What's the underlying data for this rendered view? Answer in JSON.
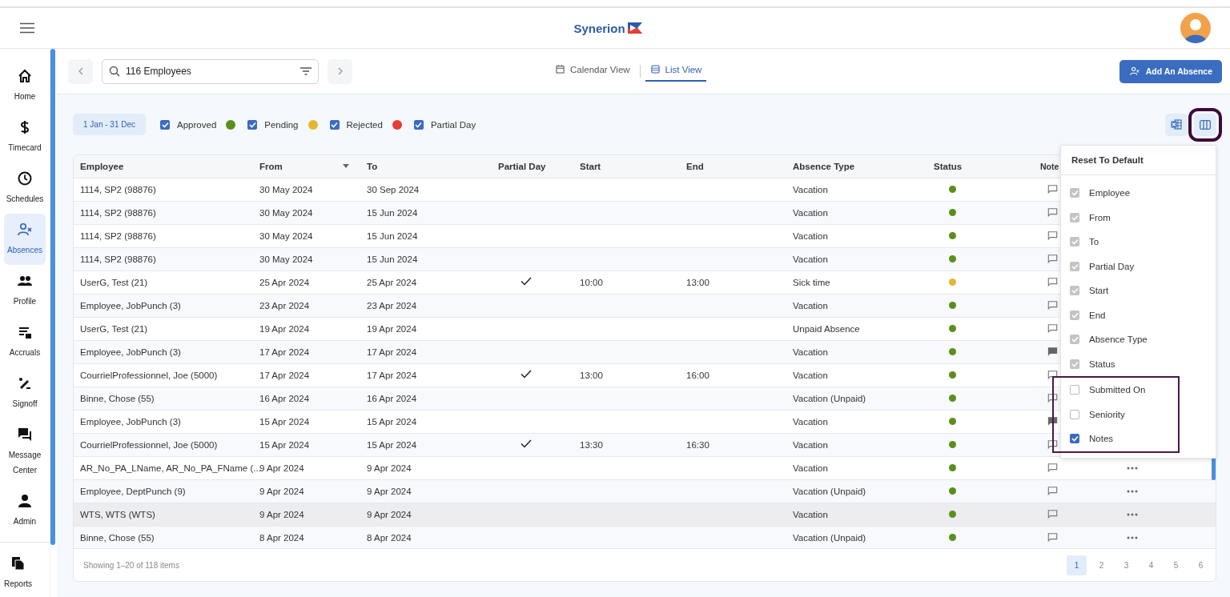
{
  "header": {
    "logo_text": "Synerion"
  },
  "sidebar": {
    "items": [
      {
        "label": "Home",
        "selected": false
      },
      {
        "label": "Timecard",
        "selected": false
      },
      {
        "label": "Schedules",
        "selected": false
      },
      {
        "label": "Absences",
        "selected": true
      },
      {
        "label": "Profile",
        "selected": false
      },
      {
        "label": "Accruals",
        "selected": false
      },
      {
        "label": "Signoff",
        "selected": false
      },
      {
        "label": "Message Center",
        "selected": false
      },
      {
        "label": "Admin",
        "selected": false
      }
    ],
    "bottom_items": [
      {
        "label": "Reports",
        "selected": false
      }
    ]
  },
  "toolbar": {
    "search": {
      "value": "116 Employees"
    },
    "view_tabs": [
      {
        "label": "Calendar View",
        "selected": false
      },
      {
        "label": "List View",
        "selected": true
      }
    ],
    "add_button": "Add An Absence"
  },
  "filters": {
    "date_range": "1 Jan - 31 Dec",
    "legend": [
      {
        "label": "Approved",
        "checked": true,
        "color": "#5a8f1c"
      },
      {
        "label": "Pending",
        "checked": true,
        "color": "#e4b731"
      },
      {
        "label": "Rejected",
        "checked": true,
        "color": "#e53e33"
      },
      {
        "label": "Partial Day",
        "checked": true
      }
    ],
    "columns_button": {
      "highlighted": true
    }
  },
  "table": {
    "columns": [
      {
        "label": "Employee"
      },
      {
        "label": "From",
        "sorted": true
      },
      {
        "label": "To"
      },
      {
        "label": "Partial Day"
      },
      {
        "label": "Start"
      },
      {
        "label": "End"
      },
      {
        "label": "Absence Type"
      },
      {
        "label": "Status"
      },
      {
        "label": "Note"
      }
    ],
    "rows": [
      {
        "employee": "1114, SP2 (98876)",
        "from": "30 May 2024",
        "to": "30 Sep 2024",
        "partial_day": false,
        "start": "",
        "end": "",
        "absence_type": "Vacation",
        "color": "#5a8f1c",
        "has_notes": false,
        "more_menu": false,
        "highlighted": false
      },
      {
        "employee": "1114, SP2 (98876)",
        "from": "30 May 2024",
        "to": "15 Jun 2024",
        "partial_day": false,
        "start": "",
        "end": "",
        "absence_type": "Vacation",
        "color": "#5a8f1c",
        "has_notes": false,
        "more_menu": false,
        "highlighted": false
      },
      {
        "employee": "1114, SP2 (98876)",
        "from": "30 May 2024",
        "to": "15 Jun 2024",
        "partial_day": false,
        "start": "",
        "end": "",
        "absence_type": "Vacation",
        "color": "#5a8f1c",
        "has_notes": false,
        "more_menu": false,
        "highlighted": false
      },
      {
        "employee": "1114, SP2 (98876)",
        "from": "30 May 2024",
        "to": "15 Jun 2024",
        "partial_day": false,
        "start": "",
        "end": "",
        "absence_type": "Vacation",
        "color": "#5a8f1c",
        "has_notes": false,
        "more_menu": false,
        "highlighted": false
      },
      {
        "employee": "UserG, Test (21)",
        "from": "25 Apr 2024",
        "to": "25 Apr 2024",
        "partial_day": true,
        "start": "10:00",
        "end": "13:00",
        "absence_type": "Sick time",
        "color": "#e4b731",
        "has_notes": false,
        "more_menu": false,
        "highlighted": false
      },
      {
        "employee": "Employee, JobPunch (3)",
        "from": "23 Apr 2024",
        "to": "23 Apr 2024",
        "partial_day": false,
        "start": "",
        "end": "",
        "absence_type": "Vacation",
        "color": "#5a8f1c",
        "has_notes": false,
        "more_menu": false,
        "highlighted": false
      },
      {
        "employee": "UserG, Test (21)",
        "from": "19 Apr 2024",
        "to": "19 Apr 2024",
        "partial_day": false,
        "start": "",
        "end": "",
        "absence_type": "Unpaid Absence",
        "color": "#5a8f1c",
        "has_notes": false,
        "more_menu": false,
        "highlighted": false
      },
      {
        "employee": "Employee, JobPunch (3)",
        "from": "17 Apr 2024",
        "to": "17 Apr 2024",
        "partial_day": false,
        "start": "",
        "end": "",
        "absence_type": "Vacation",
        "color": "#5a8f1c",
        "has_notes": true,
        "more_menu": false,
        "highlighted": false
      },
      {
        "employee": "CourrielProfessionnel, Joe (5000)",
        "from": "17 Apr 2024",
        "to": "17 Apr 2024",
        "partial_day": true,
        "start": "13:00",
        "end": "16:00",
        "absence_type": "Vacation",
        "color": "#5a8f1c",
        "has_notes": false,
        "more_menu": false,
        "highlighted": false
      },
      {
        "employee": "Binne, Chose (55)",
        "from": "16 Apr 2024",
        "to": "16 Apr 2024",
        "partial_day": false,
        "start": "",
        "end": "",
        "absence_type": "Vacation (Unpaid)",
        "color": "#5a8f1c",
        "has_notes": false,
        "more_menu": false,
        "highlighted": false
      },
      {
        "employee": "Employee, JobPunch (3)",
        "from": "15 Apr 2024",
        "to": "15 Apr 2024",
        "partial_day": false,
        "start": "",
        "end": "",
        "absence_type": "Vacation",
        "color": "#5a8f1c",
        "has_notes": true,
        "more_menu": false,
        "highlighted": false
      },
      {
        "employee": "CourrielProfessionnel, Joe (5000)",
        "from": "15 Apr 2024",
        "to": "15 Apr 2024",
        "partial_day": true,
        "start": "13:30",
        "end": "16:30",
        "absence_type": "Vacation",
        "color": "#5a8f1c",
        "has_notes": false,
        "more_menu": false,
        "highlighted": false
      },
      {
        "employee": "AR_No_PA_LName, AR_No_PA_FName (...",
        "from": "9 Apr 2024",
        "to": "9 Apr 2024",
        "partial_day": false,
        "start": "",
        "end": "",
        "absence_type": "Vacation",
        "color": "#5a8f1c",
        "has_notes": false,
        "more_menu": true,
        "highlighted": false
      },
      {
        "employee": "Employee, DeptPunch (9)",
        "from": "9 Apr 2024",
        "to": "9 Apr 2024",
        "partial_day": false,
        "start": "",
        "end": "",
        "absence_type": "Vacation (Unpaid)",
        "color": "#5a8f1c",
        "has_notes": false,
        "more_menu": true,
        "highlighted": false
      },
      {
        "employee": "WTS, WTS (WTS)",
        "from": "9 Apr 2024",
        "to": "9 Apr 2024",
        "partial_day": false,
        "start": "",
        "end": "",
        "absence_type": "Vacation",
        "color": "#5a8f1c",
        "has_notes": false,
        "more_menu": true,
        "highlighted": true
      },
      {
        "employee": "Binne, Chose (55)",
        "from": "8 Apr 2024",
        "to": "8 Apr 2024",
        "partial_day": false,
        "start": "",
        "end": "",
        "absence_type": "Vacation (Unpaid)",
        "color": "#5a8f1c",
        "has_notes": false,
        "more_menu": true,
        "highlighted": false
      }
    ],
    "footer": "Showing 1–20 of 118 items",
    "pages": [
      {
        "label": "1",
        "selected": true
      },
      {
        "label": "2",
        "selected": false
      },
      {
        "label": "3",
        "selected": false
      },
      {
        "label": "4",
        "selected": false
      },
      {
        "label": "5",
        "selected": false
      },
      {
        "label": "6",
        "selected": false
      }
    ]
  },
  "column_menu": {
    "reset": "Reset To Default",
    "options": [
      {
        "label": "Employee",
        "checked": true,
        "disabled": true
      },
      {
        "label": "From",
        "checked": true,
        "disabled": true
      },
      {
        "label": "To",
        "checked": true,
        "disabled": true
      },
      {
        "label": "Partial Day",
        "checked": true,
        "disabled": true
      },
      {
        "label": "Start",
        "checked": true,
        "disabled": true
      },
      {
        "label": "End",
        "checked": true,
        "disabled": true
      },
      {
        "label": "Absence Type",
        "checked": true,
        "disabled": true
      },
      {
        "label": "Status",
        "checked": true,
        "disabled": true
      }
    ],
    "highlighted_options": [
      {
        "label": "Submitted On",
        "checked": false,
        "disabled": false
      },
      {
        "label": "Seniority",
        "checked": false,
        "disabled": false
      },
      {
        "label": "Notes",
        "checked": true,
        "disabled": false
      }
    ]
  }
}
